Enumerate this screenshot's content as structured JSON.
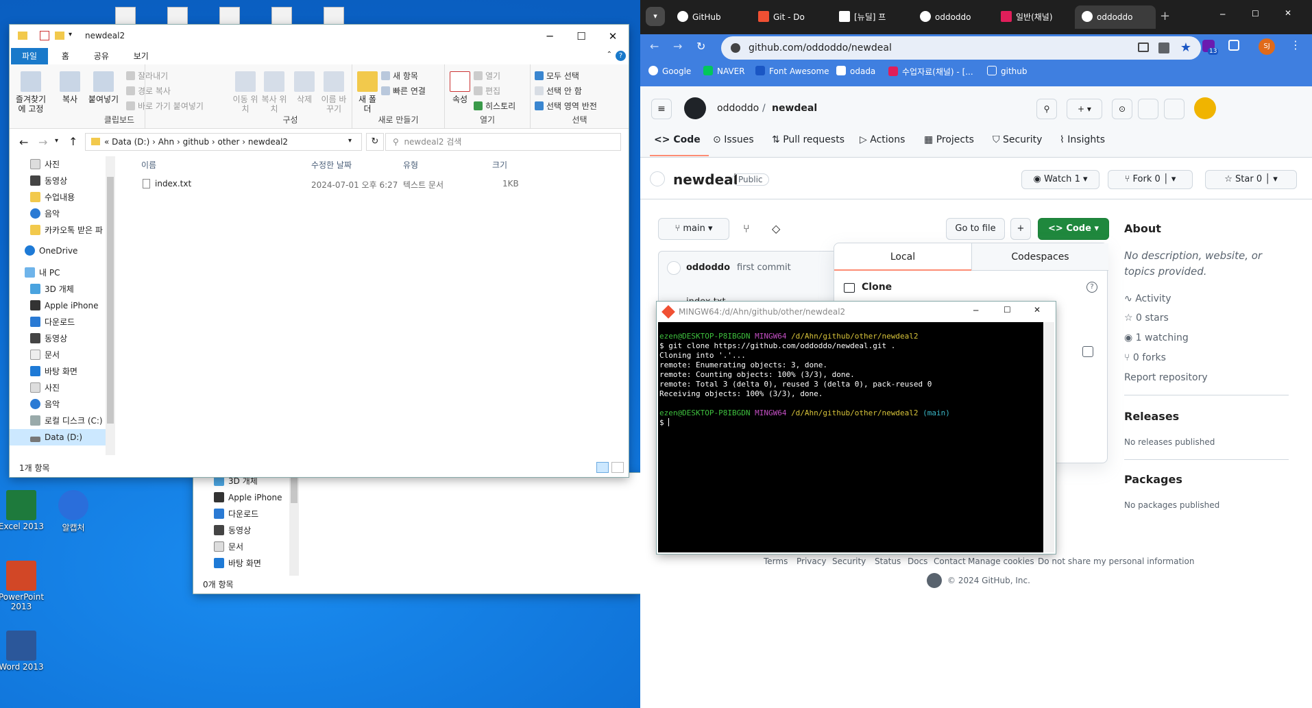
{
  "desktop": {
    "icons": [
      {
        "label": "Excel 2013",
        "color": "#1e7a3c"
      },
      {
        "label": "알캡처",
        "color": "#2a6edb"
      },
      {
        "label": "PowerPoint 2013",
        "color": "#d24726"
      },
      {
        "label": "Word 2013",
        "color": "#2b579a"
      }
    ]
  },
  "explorer": {
    "title": "newdeal2",
    "tabs": [
      "파일",
      "홈",
      "공유",
      "보기"
    ],
    "ribbon": {
      "clipboard": {
        "pin": "즐겨찾기에 고정",
        "copy": "복사",
        "paste": "붙여넣기",
        "cut": "잘라내기",
        "copy_path": "경로 복사",
        "paste_shortcut": "바로 가기 붙여넣기",
        "label": "클립보드"
      },
      "organize": {
        "move": "이동 위치",
        "copy_to": "복사 위치",
        "delete": "삭제",
        "rename": "이름 바꾸기",
        "label": "구성"
      },
      "new": {
        "folder": "새 폴더",
        "new_item": "새 항목",
        "easy_access": "빠른 연결",
        "label": "새로 만들기"
      },
      "open": {
        "props": "속성",
        "open": "열기",
        "edit": "편집",
        "history": "히스토리",
        "label": "열기"
      },
      "select": {
        "all": "모두 선택",
        "none": "선택 안 함",
        "invert": "선택 영역 반전",
        "label": "선택"
      }
    },
    "breadcrumb": [
      "Data (D:)",
      "Ahn",
      "github",
      "other",
      "newdeal2"
    ],
    "search_placeholder": "newdeal2 검색",
    "columns": [
      "이름",
      "수정한 날짜",
      "유형",
      "크기"
    ],
    "files": [
      {
        "name": "index.txt",
        "date": "2024-07-01 오후 6:27",
        "type": "텍스트 문서",
        "size": "1KB"
      }
    ],
    "nav": [
      "사진",
      "동영상",
      "수업내용",
      "음악",
      "카카오톡 받은 파",
      "OneDrive",
      "내 PC",
      "3D 개체",
      "Apple iPhone",
      "다운로드",
      "동영상",
      "문서",
      "바탕 화면",
      "사진",
      "음악",
      "로컬 디스크 (C:)",
      "Data (D:)"
    ],
    "status": "1개 항목"
  },
  "explorer_back": {
    "nav": [
      "3D 개체",
      "Apple iPhone",
      "다운로드",
      "동영상",
      "문서",
      "바탕 화면"
    ],
    "status": "0개 항목"
  },
  "chrome": {
    "tabs": [
      {
        "label": "GitHub",
        "color": "#ffffff"
      },
      {
        "label": "Git - Do",
        "color": "#f05033"
      },
      {
        "label": "[뉴딜] 프",
        "color": "#ffffff"
      },
      {
        "label": "oddoddo",
        "color": "#ffffff"
      },
      {
        "label": "일반(채널)",
        "color": "#e01e5a"
      },
      {
        "label": "oddoddo",
        "color": "#ffffff"
      }
    ],
    "url": "github.com/oddoddo/newdeal",
    "bookmarks": [
      "Google",
      "NAVER",
      "Font Awesome",
      "odada",
      "수업자료(채널) - [...",
      "github"
    ],
    "profile": "SJ",
    "ext_badge": "13"
  },
  "github": {
    "owner": "oddoddo",
    "repo": "newdeal",
    "tabs": [
      "Code",
      "Issues",
      "Pull requests",
      "Actions",
      "Projects",
      "Security",
      "Insights"
    ],
    "visibility": "Public",
    "watch": "Watch",
    "watch_count": "1",
    "fork": "Fork",
    "fork_count": "0",
    "star": "Star",
    "star_count": "0",
    "branch": "main",
    "go_to_file": "Go to file",
    "code_btn": "Code",
    "commit_author": "oddoddo",
    "commit_msg": "first commit",
    "file_peek": "index.txt",
    "dropdown": {
      "local": "Local",
      "codespaces": "Codespaces",
      "clone": "Clone"
    },
    "about": {
      "title": "About",
      "desc": "No description, website, or topics provided.",
      "activity": "Activity",
      "stars": "0 stars",
      "watching": "1 watching",
      "forks": "0 forks",
      "report": "Report repository"
    },
    "releases": {
      "title": "Releases",
      "text": "No releases published"
    },
    "packages": {
      "title": "Packages",
      "text": "No packages published"
    },
    "footer": [
      "Terms",
      "Privacy",
      "Security",
      "Status",
      "Docs",
      "Contact",
      "Manage cookies",
      "Do not share my personal information"
    ],
    "copyright": "© 2024 GitHub, Inc."
  },
  "terminal": {
    "title": "MINGW64:/d/Ahn/github/other/newdeal2",
    "user": "ezen@DESKTOP-P8IBGDN",
    "env": "MINGW64",
    "path": "/d/Ahn/github/other/newdeal2",
    "branch": "(main)",
    "cmd": "$ git clone https://github.com/oddoddo/newdeal.git .",
    "out": [
      "Cloning into '.'...",
      "remote: Enumerating objects: 3, done.",
      "remote: Counting objects: 100% (3/3), done.",
      "remote: Total 3 (delta 0), reused 3 (delta 0), pack-reused 0",
      "Receiving objects: 100% (3/3), done."
    ],
    "prompt": "$"
  }
}
